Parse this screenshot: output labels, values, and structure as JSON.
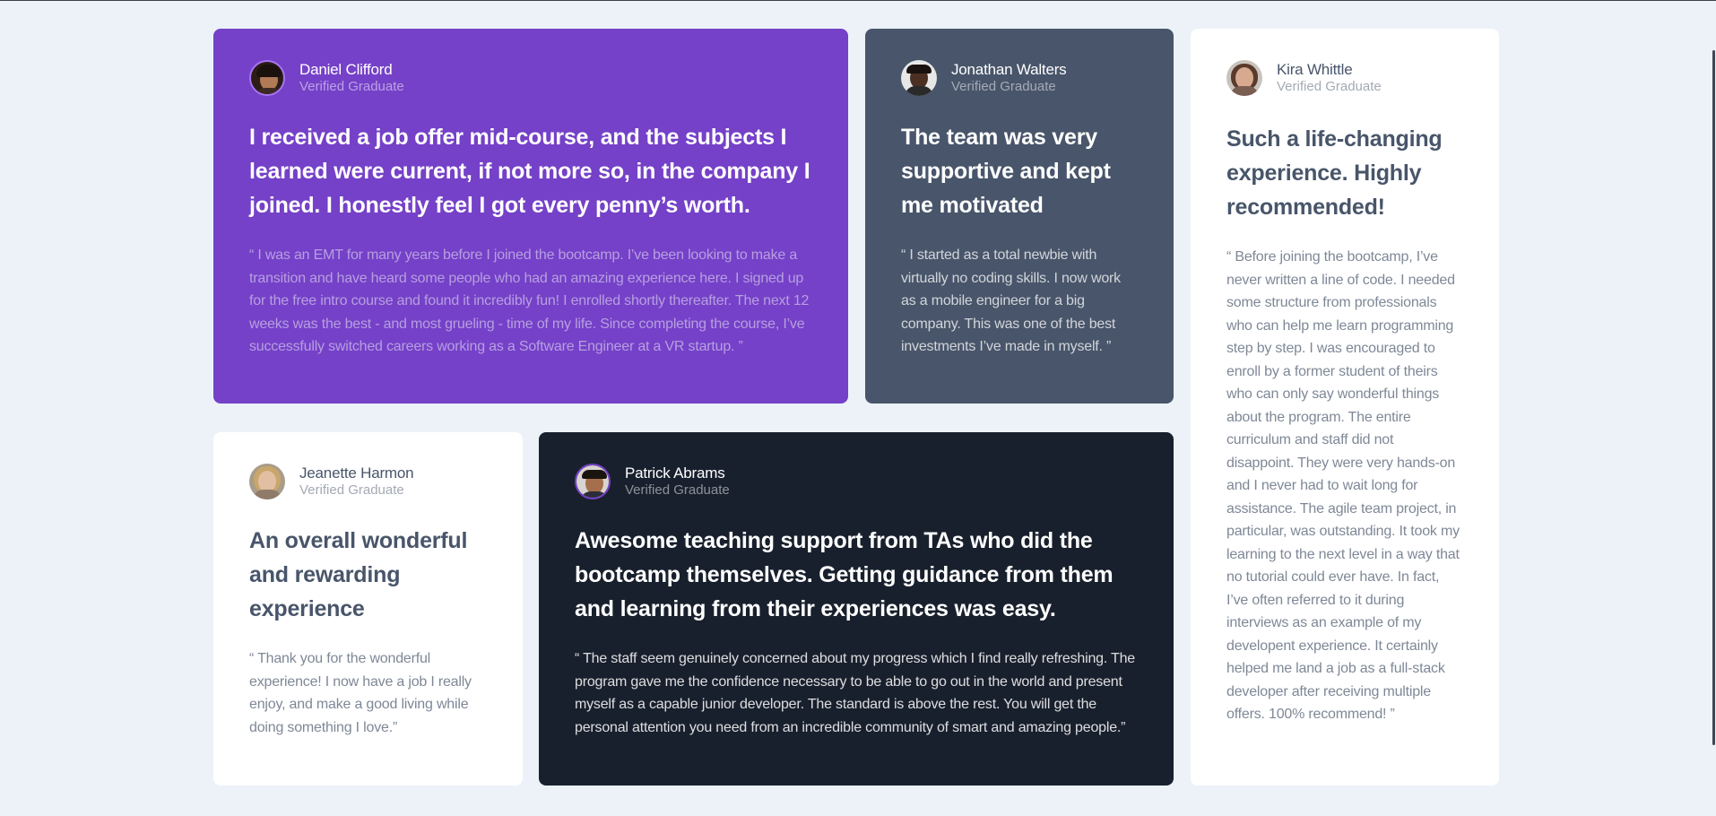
{
  "testimonials": [
    {
      "name": "Daniel Clifford",
      "role": "Verified Graduate",
      "headline": "I received a job offer mid-course, and the subjects I learned were current, if not more so, in the company I joined. I honestly feel I got every penny’s worth.",
      "quote": "“ I was an EMT for many years before I joined the bootcamp. I’ve been looking to make a transition and have heard some people who had an amazing experience here. I signed up for the free intro course and found it incredibly fun! I enrolled shortly thereafter. The next 12 weeks was the best - and most grueling - time of my life. Since completing the course, I’ve successfully switched careers working as a Software Engineer at a VR startup. ”",
      "card_color": "#7541c8"
    },
    {
      "name": "Jonathan Walters",
      "role": "Verified Graduate",
      "headline": "The team was very supportive and kept me motivated",
      "quote": "“ I started as a total newbie with virtually no coding skills. I now work as a mobile engineer for a big company. This was one of the best investments I’ve made in myself. ”",
      "card_color": "#48556a"
    },
    {
      "name": "Kira Whittle",
      "role": "Verified Graduate",
      "headline": "Such a life-changing experience. Highly recommended!",
      "quote": "“ Before joining the bootcamp, I’ve never written a line of code. I needed some structure from professionals who can help me learn programming step by step. I was encouraged to enroll by a former student of theirs who can only say wonderful things about the program. The entire curriculum and staff did not disappoint. They were very hands-on and I never had to wait long for assistance. The agile team project, in particular, was outstanding. It took my learning to the next level in a way that no tutorial could ever have. In fact, I’ve often referred to it during interviews as an example of my developent experience. It certainly helped me land a job as a full-stack developer after receiving multiple offers. 100% recommend! ”",
      "card_color": "#ffffff"
    },
    {
      "name": "Jeanette Harmon",
      "role": "Verified Graduate",
      "headline": "An overall wonderful and rewarding experience",
      "quote": "“ Thank you for the wonderful experience! I now have a job I really enjoy, and make a good living while doing something I love.”",
      "card_color": "#ffffff"
    },
    {
      "name": "Patrick Abrams",
      "role": "Verified Graduate",
      "headline": "Awesome teaching support from TAs who did the bootcamp themselves. Getting guidance from them and learning from their experiences was easy.",
      "quote": "“ The staff seem genuinely concerned about my progress which I find really refreshing. The program gave me the confidence necessary to be able to go out in the world and present myself as a capable junior developer. The standard is above the rest. You will get the personal attention you need from an incredible community of smart and amazing people.”",
      "card_color": "#19202d"
    }
  ],
  "colors": {
    "page_background": "#ecf2f8",
    "accent_violet": "#7541c8",
    "grayish_blue": "#48556a",
    "dark_blackish_blue": "#19202d"
  }
}
